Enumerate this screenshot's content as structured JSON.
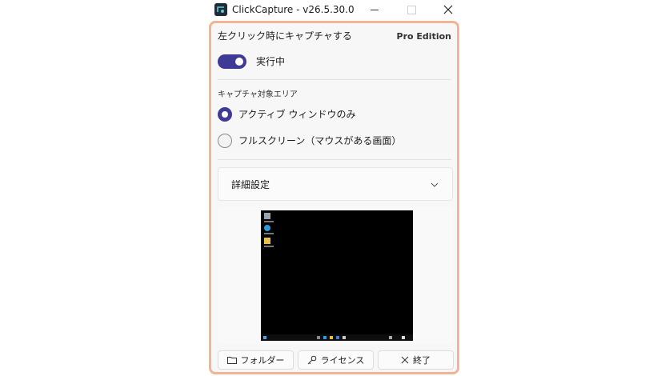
{
  "window": {
    "title": "ClickCapture - v26.5.30.0",
    "accent": "#3f3a95",
    "panel_border": "#f1b596"
  },
  "header": {
    "click_label": "左クリック時にキャプチャする",
    "edition": "Pro Edition"
  },
  "capture_toggle": {
    "on": true,
    "label": "実行中"
  },
  "capture_area": {
    "section_label": "キャプチャ対象エリア",
    "options": [
      {
        "label": "アクティブ ウィンドウのみ",
        "selected": true
      },
      {
        "label": "フルスクリーン（マウスがある画面）",
        "selected": false
      }
    ]
  },
  "advanced": {
    "label": "詳細設定",
    "icon": "chevron-down-icon"
  },
  "footer": {
    "folder_label": "フォルダー",
    "folder_icon": "folder-icon",
    "license_label": "ライセンス",
    "license_icon": "key-icon",
    "exit_label": "終了",
    "exit_icon": "close-icon"
  }
}
